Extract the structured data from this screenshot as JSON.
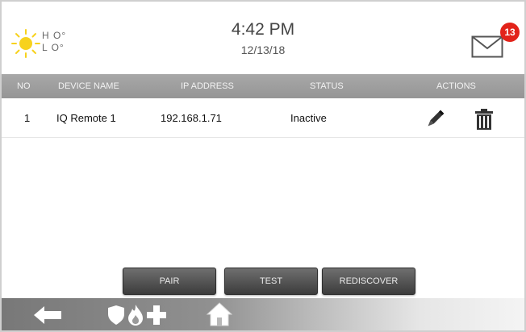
{
  "header": {
    "weather": {
      "icon": "sun-icon",
      "high": "H O°",
      "low": "L O°"
    },
    "time": "4:42 PM",
    "date": "12/13/18",
    "messages": {
      "icon": "envelope-icon",
      "count": "13"
    }
  },
  "table": {
    "columns": [
      "NO",
      "DEVICE NAME",
      "IP ADDRESS",
      "STATUS",
      "ACTIONS"
    ],
    "rows": [
      {
        "no": "1",
        "device_name": "IQ Remote 1",
        "ip_address": "192.168.1.71",
        "status": "Inactive",
        "actions": [
          "pencil-icon",
          "trash-icon"
        ]
      }
    ]
  },
  "buttons": {
    "pair": "PAIR",
    "test": "TEST",
    "rediscover": "REDISCOVER"
  },
  "navbar": {
    "items": [
      "back-arrow-icon",
      "shield-icon",
      "flame-icon",
      "medical-cross-icon",
      "home-icon"
    ]
  },
  "colors": {
    "header_bar": "#9e9e9e",
    "badge": "#e2231a",
    "button": "#4a4a4a",
    "sun": "#f7d21d"
  }
}
